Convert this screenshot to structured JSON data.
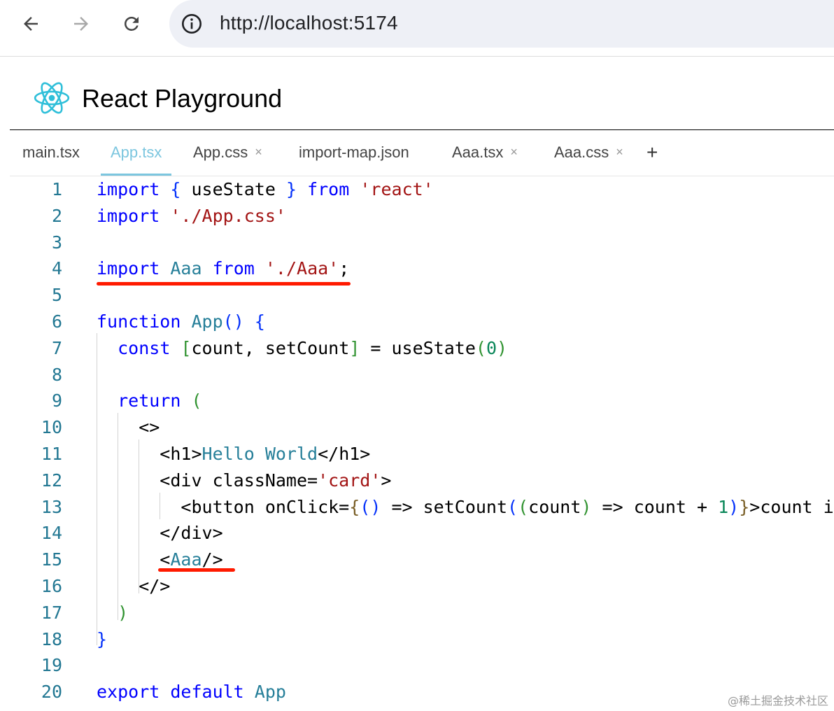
{
  "browser": {
    "url": "http://localhost:5174",
    "icons": [
      "back-arrow-icon",
      "forward-arrow-icon",
      "reload-icon",
      "info-icon"
    ]
  },
  "app": {
    "title": "React Playground",
    "logo_icon": "react-logo-icon"
  },
  "tabs": [
    {
      "label": "main.tsx",
      "closable": false,
      "active": false
    },
    {
      "label": "App.tsx",
      "closable": false,
      "active": true
    },
    {
      "label": "App.css",
      "closable": true,
      "active": false
    },
    {
      "label": "import-map.json",
      "closable": false,
      "active": false
    },
    {
      "label": "Aaa.tsx",
      "closable": true,
      "active": false
    },
    {
      "label": "Aaa.css",
      "closable": true,
      "active": false
    }
  ],
  "tab_close_glyph": "×",
  "add_tab_glyph": "+",
  "line_numbers": [
    "1",
    "2",
    "3",
    "4",
    "5",
    "6",
    "7",
    "8",
    "9",
    "10",
    "11",
    "12",
    "13",
    "14",
    "15",
    "16",
    "17",
    "18",
    "19",
    "20"
  ],
  "code_lines": [
    "import { useState } from 'react'",
    "import './App.css'",
    "",
    "import Aaa from './Aaa';",
    "",
    "function App() {",
    "  const [count, setCount] = useState(0)",
    "",
    "  return (",
    "    <>",
    "      <h1>Hello World</h1>",
    "      <div className='card'>",
    "        <button onClick={() => setCount((count) => count + 1)}>count i",
    "      </div>",
    "      <Aaa/>",
    "    </>",
    "  )",
    "}",
    "",
    "export default App"
  ],
  "colors": {
    "keyword": "#0000ff",
    "string": "#a31515",
    "type": "#267f99",
    "line_number": "#237893",
    "active_tab": "#7cc6df",
    "annotation": "#ff1a00"
  },
  "watermark": "@稀土掘金技术社区"
}
